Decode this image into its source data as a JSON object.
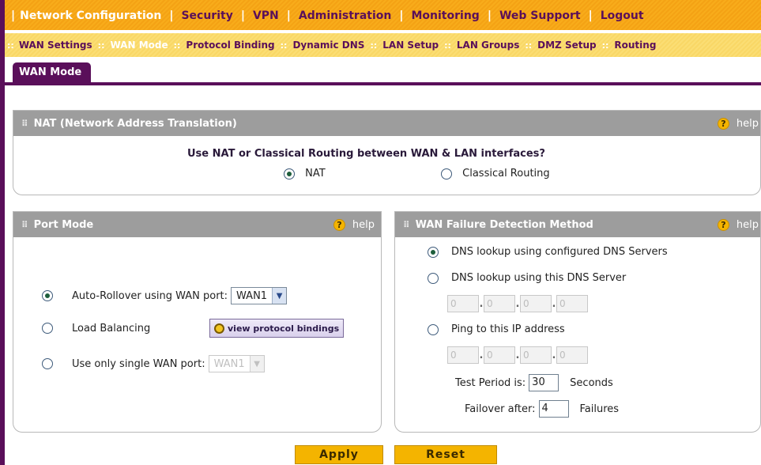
{
  "top_menu": {
    "items": [
      {
        "label": "Network Configuration",
        "active": true
      },
      {
        "label": "Security"
      },
      {
        "label": "VPN"
      },
      {
        "label": "Administration"
      },
      {
        "label": "Monitoring"
      },
      {
        "label": "Web Support"
      },
      {
        "label": "Logout"
      }
    ]
  },
  "sub_menu": {
    "items": [
      {
        "label": "WAN Settings"
      },
      {
        "label": "WAN Mode",
        "active": true
      },
      {
        "label": "Protocol Binding"
      },
      {
        "label": "Dynamic DNS"
      },
      {
        "label": "LAN Setup"
      },
      {
        "label": "LAN Groups"
      },
      {
        "label": "DMZ Setup"
      },
      {
        "label": "Routing"
      }
    ]
  },
  "tab": {
    "label": "WAN Mode"
  },
  "nat_panel": {
    "title": "NAT (Network Address Translation)",
    "help_label": "help",
    "question": "Use NAT or Classical Routing between WAN & LAN interfaces?",
    "options": [
      {
        "label": "NAT",
        "selected": true
      },
      {
        "label": "Classical Routing",
        "selected": false
      }
    ]
  },
  "port_mode_panel": {
    "title": "Port Mode",
    "help_label": "help",
    "auto_rollover": {
      "label": "Auto-Rollover using WAN port:",
      "selected": true,
      "value": "WAN1"
    },
    "load_balancing": {
      "label": "Load Balancing",
      "selected": false,
      "button_label": "view protocol bindings"
    },
    "single_wan": {
      "label": "Use only single WAN port:",
      "selected": false,
      "value": "WAN1"
    }
  },
  "failure_panel": {
    "title": "WAN Failure Detection Method",
    "help_label": "help",
    "dns_configured": {
      "label": "DNS lookup using configured DNS Servers",
      "selected": true
    },
    "dns_this": {
      "label": "DNS lookup using this DNS Server",
      "selected": false,
      "octets": [
        "0",
        "0",
        "0",
        "0"
      ]
    },
    "ping": {
      "label": "Ping to this IP address",
      "selected": false,
      "octets": [
        "0",
        "0",
        "0",
        "0"
      ]
    },
    "test_period": {
      "label": "Test Period is:",
      "value": "30",
      "unit": "Seconds"
    },
    "failover": {
      "label": "Failover after:",
      "value": "4",
      "unit": "Failures"
    }
  },
  "actions": {
    "apply_label": "Apply",
    "reset_label": "Reset"
  },
  "colors": {
    "menu_orange": "#f4a214",
    "submenu_yellow": "#f9d766",
    "brand_purple": "#5a0f5a",
    "panel_gray": "#9d9d9d",
    "button_gold": "#f4b400"
  }
}
